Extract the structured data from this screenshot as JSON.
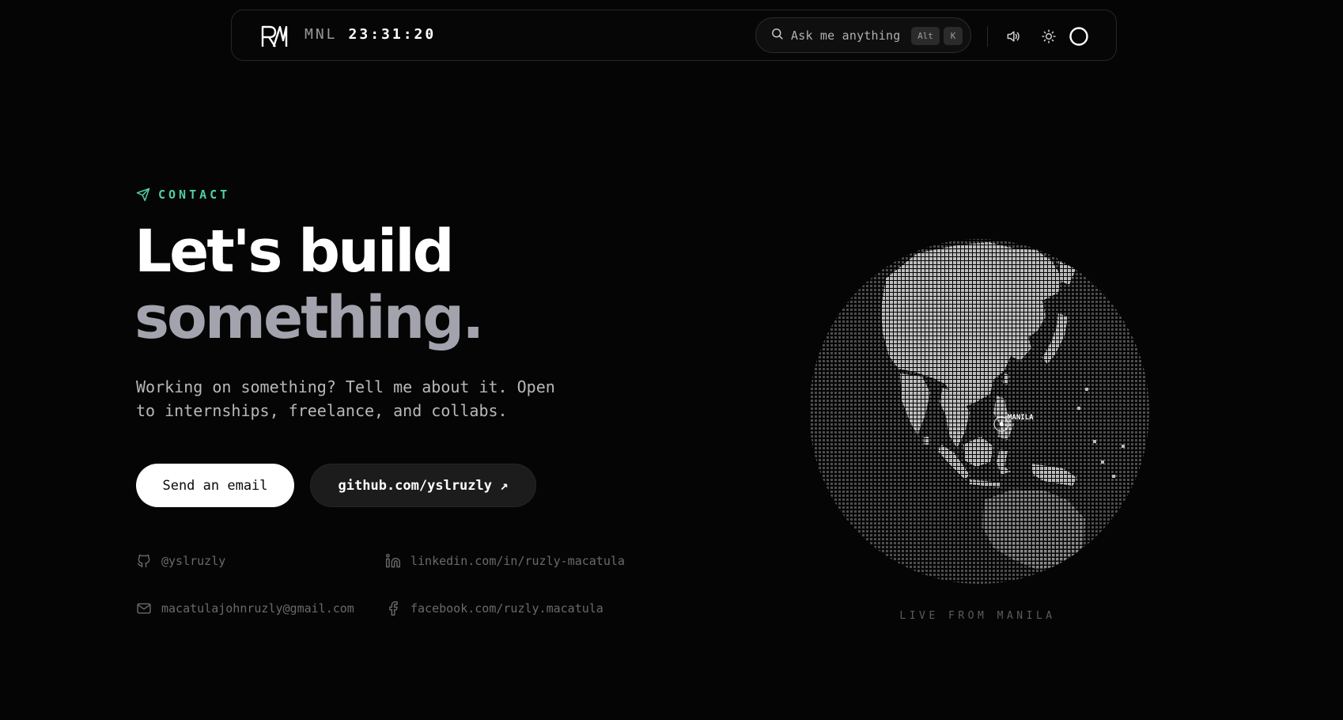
{
  "navbar": {
    "logo_text": "R/I",
    "clock_city": "MNL",
    "clock_time": "23:31:20",
    "search_placeholder": "Ask me anything",
    "shortcut_keys": [
      "Alt",
      "K"
    ],
    "icons": [
      "search-icon",
      "speaker-icon",
      "sun-icon",
      "ring-icon"
    ]
  },
  "hero": {
    "section_label": "CONTACT",
    "section_icon": "send-icon",
    "headline_line1": "Let's build",
    "headline_line2": "something.",
    "intro": "Working on something? Tell me about it. Open to internships, freelance, and collabs.",
    "primary_button": "Send an email",
    "secondary_button": "github.com/yslruzly ↗"
  },
  "links": [
    {
      "icon": "github-icon",
      "label": "@yslruzly"
    },
    {
      "icon": "linkedin-icon",
      "label": "linkedin.com/in/ruzly-macatula"
    },
    {
      "icon": "mail-icon",
      "label": "macatulajohnruzly@gmail.com"
    },
    {
      "icon": "facebook-icon",
      "label": "facebook.com/ruzly.macatula"
    }
  ],
  "globe": {
    "marker_label": "MANILA",
    "caption": "LIVE FROM MANILA"
  },
  "colors": {
    "background": "#050505",
    "accent": "#4fd1a1",
    "headline_muted": "#a3a3ad",
    "link_text": "#6a6a6a"
  }
}
